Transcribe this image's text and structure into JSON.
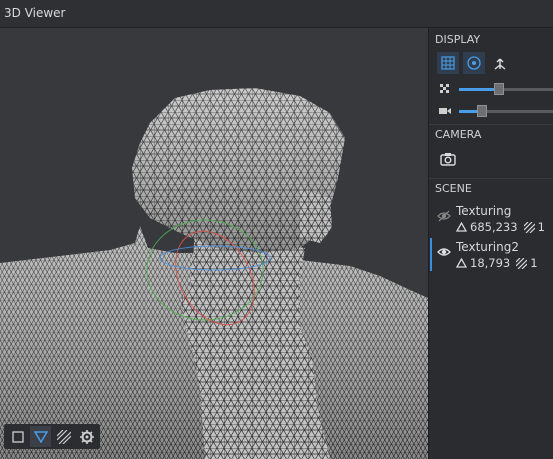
{
  "window": {
    "title": "3D Viewer"
  },
  "display": {
    "header": "DISPLAY",
    "buttons": [
      {
        "icon": "grid-icon",
        "active": true
      },
      {
        "icon": "target-icon",
        "active": true
      },
      {
        "icon": "axis-icon",
        "active": false
      }
    ],
    "sliders": [
      {
        "icon": "point-size-icon",
        "value": 0.42
      },
      {
        "icon": "camera-scale-icon",
        "value": 0.24
      }
    ]
  },
  "camera": {
    "header": "CAMERA",
    "icon": "camera-snapshot-icon"
  },
  "scene": {
    "header": "SCENE",
    "items": [
      {
        "name": "Texturing",
        "triangles": "685,233",
        "textures": "1",
        "visible": false,
        "selected": false
      },
      {
        "name": "Texturing2",
        "triangles": "18,793",
        "textures": "1",
        "visible": true,
        "selected": true
      }
    ]
  },
  "viewport_toolbar": [
    {
      "icon": "square-icon",
      "active": false
    },
    {
      "icon": "wireframe-triangle-icon",
      "active": true
    },
    {
      "icon": "texture-hatch-icon",
      "active": false
    },
    {
      "icon": "settings-gear-icon",
      "active": false
    }
  ],
  "colors": {
    "accent": "#3a8fdc",
    "mesh_fill": "#bdbdbd",
    "mesh_edge": "#3a3a3a",
    "background": "#38393d"
  }
}
